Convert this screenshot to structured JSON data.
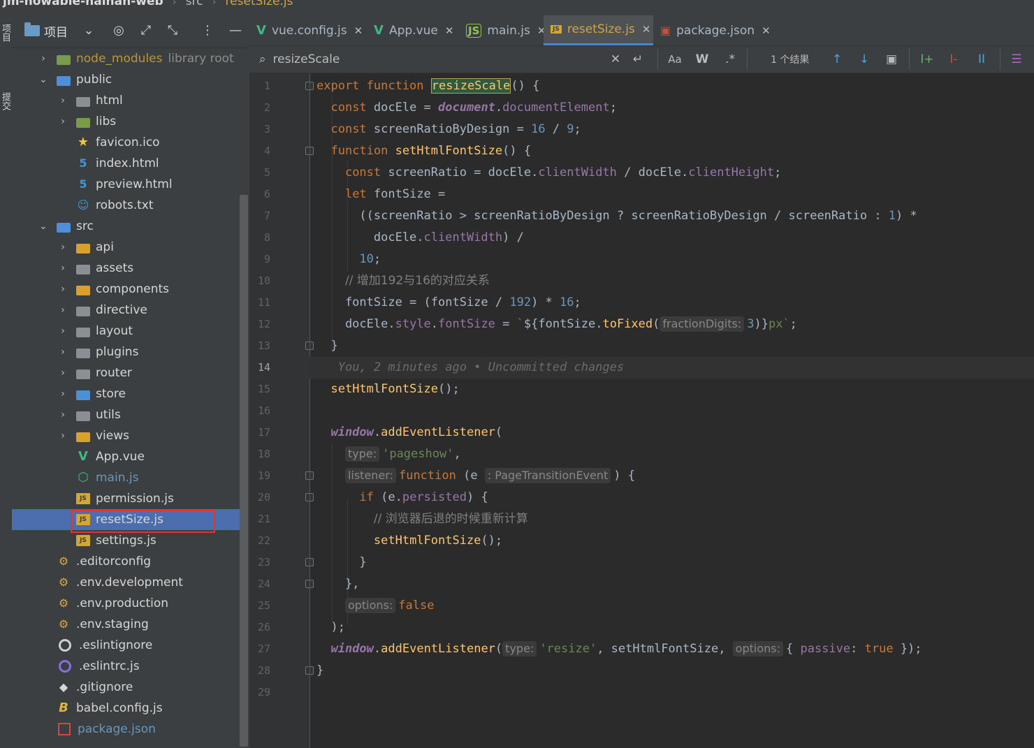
{
  "breadcrumb": {
    "project": "jm-nowable-hainan-web",
    "folder": "src",
    "file": "resetSize.js"
  },
  "left_rail": {
    "label_1": "项目",
    "label_2": "提交"
  },
  "project_panel": {
    "title": "项目",
    "tree": [
      {
        "arrow": "›",
        "icon": "fold-green",
        "label": "node_modules",
        "note": "library root",
        "indent": 38,
        "nm": true
      },
      {
        "arrow": "⌄",
        "icon": "fold-blue",
        "label": "public",
        "indent": 38
      },
      {
        "arrow": "›",
        "icon": "fold",
        "label": "html",
        "indent": 66
      },
      {
        "arrow": "›",
        "icon": "fold-green",
        "label": "libs",
        "indent": 66
      },
      {
        "arrow": "",
        "icon": "star",
        "label": "favicon.ico",
        "indent": 66
      },
      {
        "arrow": "",
        "icon": "html5",
        "label": "index.html",
        "indent": 66
      },
      {
        "arrow": "",
        "icon": "html5",
        "label": "preview.html",
        "indent": 66
      },
      {
        "arrow": "",
        "icon": "robot",
        "label": "robots.txt",
        "indent": 66
      },
      {
        "arrow": "⌄",
        "icon": "fold-blue",
        "label": "src",
        "indent": 38
      },
      {
        "arrow": "›",
        "icon": "fold-yellow",
        "label": "api",
        "indent": 66
      },
      {
        "arrow": "›",
        "icon": "fold",
        "label": "assets",
        "indent": 66
      },
      {
        "arrow": "›",
        "icon": "fold-yellow",
        "label": "components",
        "indent": 66
      },
      {
        "arrow": "›",
        "icon": "fold",
        "label": "directive",
        "indent": 66
      },
      {
        "arrow": "›",
        "icon": "fold",
        "label": "layout",
        "indent": 66
      },
      {
        "arrow": "›",
        "icon": "fold",
        "label": "plugins",
        "indent": 66
      },
      {
        "arrow": "›",
        "icon": "fold",
        "label": "router",
        "indent": 66
      },
      {
        "arrow": "›",
        "icon": "fold-blue",
        "label": "store",
        "indent": 66
      },
      {
        "arrow": "›",
        "icon": "fold",
        "label": "utils",
        "indent": 66
      },
      {
        "arrow": "›",
        "icon": "fold-yellow",
        "label": "views",
        "indent": 66
      },
      {
        "arrow": "",
        "icon": "vue",
        "label": "App.vue",
        "indent": 66
      },
      {
        "arrow": "",
        "icon": "nodejs",
        "label": "main.js",
        "indent": 66,
        "blue": true
      },
      {
        "arrow": "",
        "icon": "js",
        "label": "permission.js",
        "indent": 66
      },
      {
        "arrow": "",
        "icon": "js",
        "label": "resetSize.js",
        "indent": 66,
        "selected": true
      },
      {
        "arrow": "",
        "icon": "js",
        "label": "settings.js",
        "indent": 66
      },
      {
        "arrow": "",
        "icon": "cfg",
        "label": ".editorconfig",
        "indent": 38
      },
      {
        "arrow": "",
        "icon": "cfg",
        "label": ".env.development",
        "indent": 38
      },
      {
        "arrow": "",
        "icon": "cfg",
        "label": ".env.production",
        "indent": 38
      },
      {
        "arrow": "",
        "icon": "cfg",
        "label": ".env.staging",
        "indent": 38
      },
      {
        "arrow": "",
        "icon": "ring",
        "label": ".eslintignore",
        "indent": 38
      },
      {
        "arrow": "",
        "icon": "ring-purple",
        "label": ".eslintrc.js",
        "indent": 38
      },
      {
        "arrow": "",
        "icon": "git",
        "label": ".gitignore",
        "indent": 38
      },
      {
        "arrow": "",
        "icon": "babel",
        "label": "babel.config.js",
        "indent": 38
      },
      {
        "arrow": "",
        "icon": "pkg",
        "label": "package.json",
        "indent": 38,
        "blue": true
      }
    ]
  },
  "tabs": [
    {
      "icon": "vue",
      "label": "vue.config.js",
      "active": false
    },
    {
      "icon": "vue",
      "label": "App.vue",
      "active": false
    },
    {
      "icon": "nodejs",
      "label": "main.js",
      "active": false
    },
    {
      "icon": "js",
      "label": "resetSize.js",
      "active": true
    },
    {
      "icon": "pkg",
      "label": "package.json",
      "active": false
    }
  ],
  "search": {
    "query": "resizeScale",
    "results": "1 个结果",
    "case_label": "Aa",
    "word_label": "W",
    "regex_label": ".*"
  },
  "editor": {
    "line_count": 29,
    "current_line": 14,
    "blame": "You, 2 minutes ago • Uncommitted changes",
    "comment_1": "// 增加192与16的对应关系",
    "comment_2": "// 浏览器后退的时候重新计算",
    "hint_fraction": "fractionDigits:",
    "hint_type": "type:",
    "hint_listener": "listener:",
    "hint_options": "options:",
    "hint_event": ": PageTransitionEvent"
  }
}
